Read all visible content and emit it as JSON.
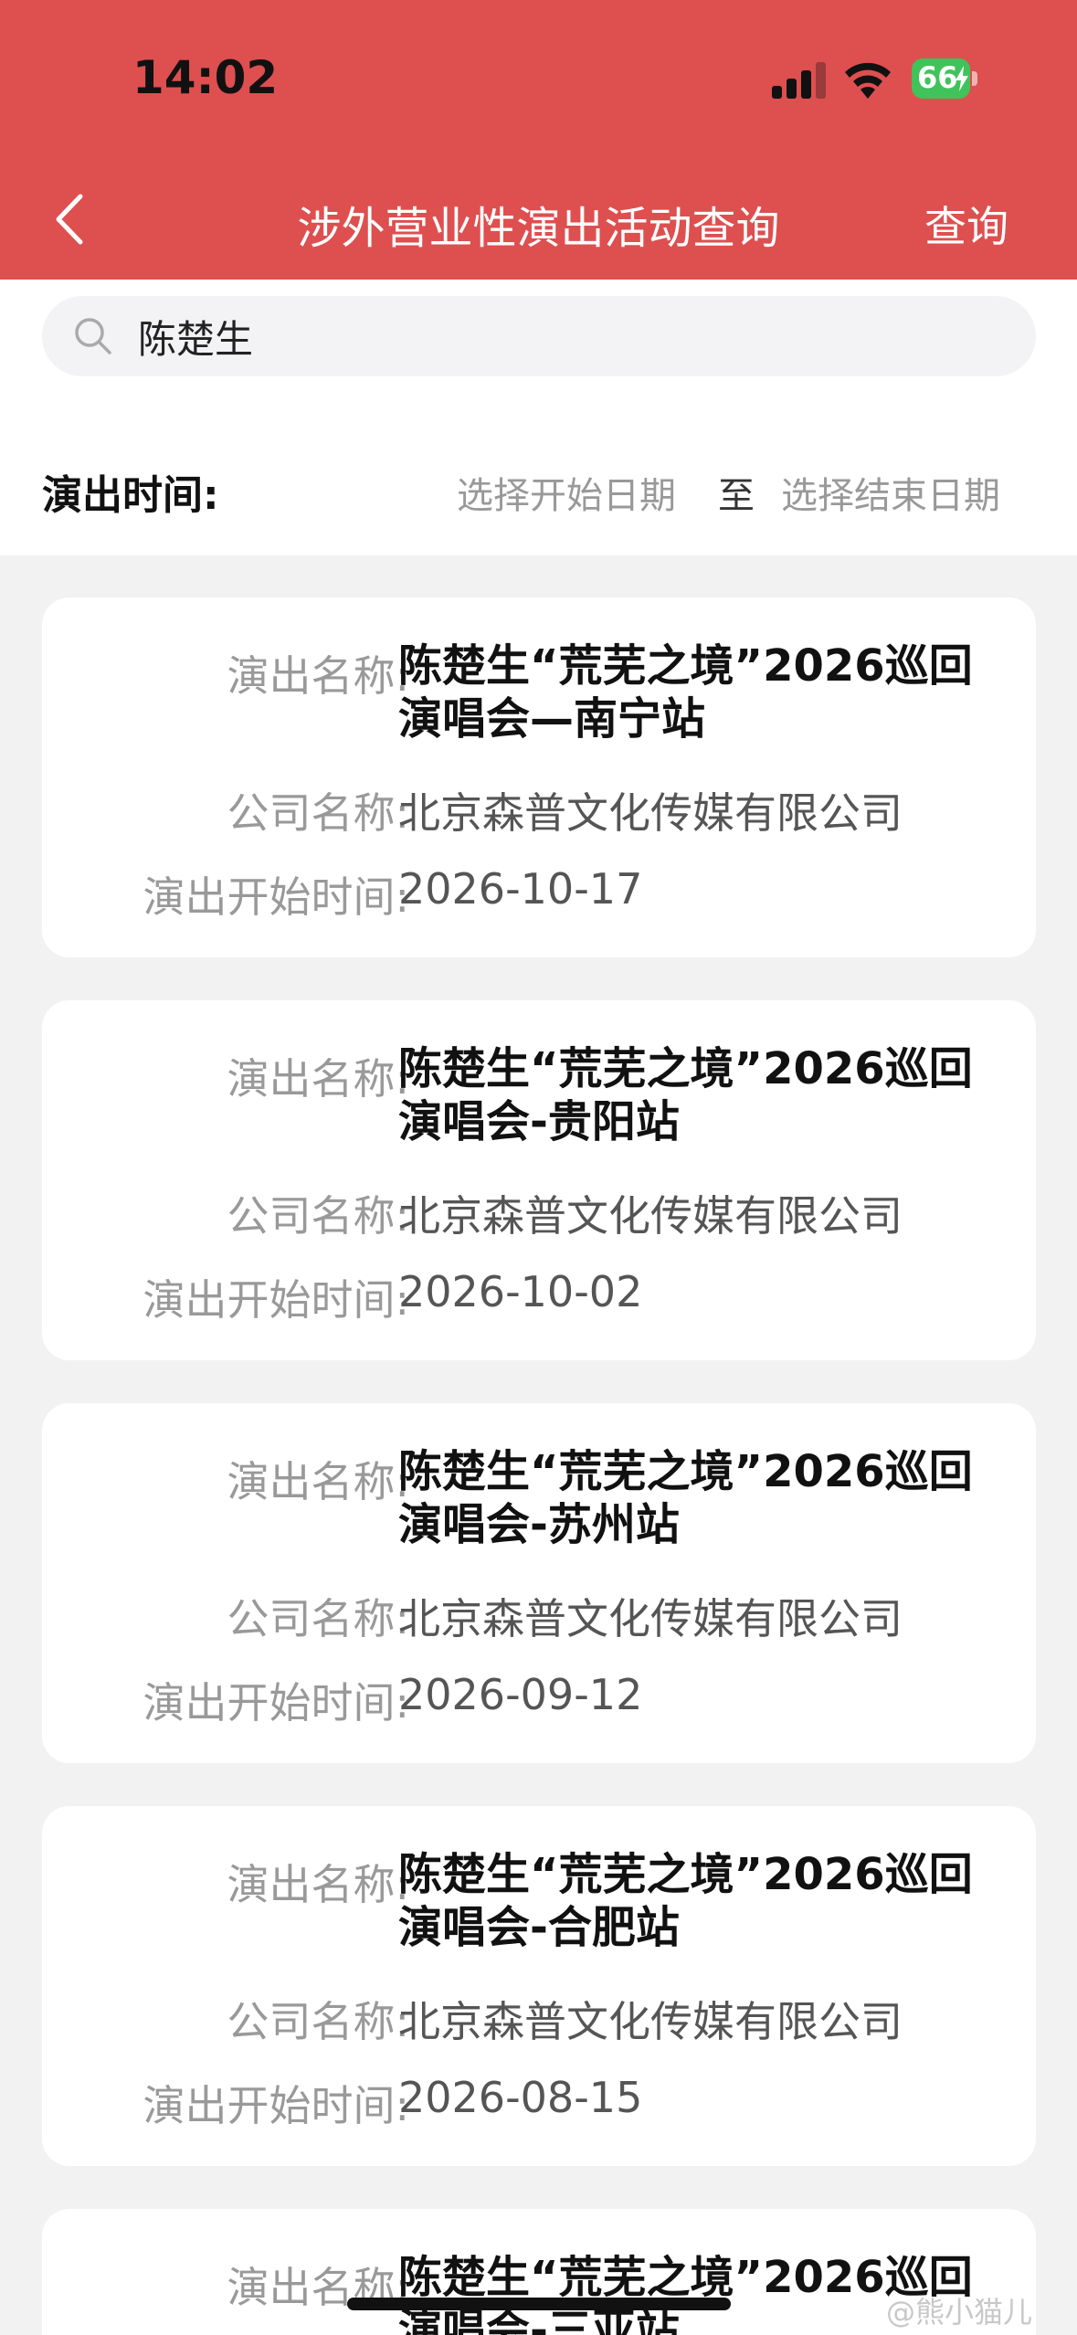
{
  "status": {
    "time": "14:02",
    "battery": "66"
  },
  "header": {
    "title": "涉外营业性演出活动查询",
    "query_label": "查询"
  },
  "search": {
    "value": "陈楚生"
  },
  "date_filter": {
    "label": "演出时间:",
    "start_placeholder": "选择开始日期",
    "separator": "至",
    "end_placeholder": "选择结束日期"
  },
  "labels": {
    "name": "演出名称:",
    "company": "公司名称:",
    "start_time": "演出开始时间:"
  },
  "results": [
    {
      "name_line1": "陈楚生“荒芜之境”2026巡回",
      "name_line2": "演唱会—南宁站",
      "company": "北京森普文化传媒有限公司",
      "start": "2026-10-17"
    },
    {
      "name_line1": "陈楚生“荒芜之境”2026巡回",
      "name_line2": "演唱会-贵阳站",
      "company": "北京森普文化传媒有限公司",
      "start": "2026-10-02"
    },
    {
      "name_line1": "陈楚生“荒芜之境”2026巡回",
      "name_line2": "演唱会-苏州站",
      "company": "北京森普文化传媒有限公司",
      "start": "2026-09-12"
    },
    {
      "name_line1": "陈楚生“荒芜之境”2026巡回",
      "name_line2": "演唱会-合肥站",
      "company": "北京森普文化传媒有限公司",
      "start": "2026-08-15"
    },
    {
      "name_line1": "陈楚生“荒芜之境”2026巡回",
      "name_line2": "演唱会-三亚站",
      "company": "",
      "start": ""
    }
  ],
  "watermark": "@熊小猫儿",
  "colors": {
    "header_bg": "#de4f4f",
    "battery": "#3fc35a"
  }
}
